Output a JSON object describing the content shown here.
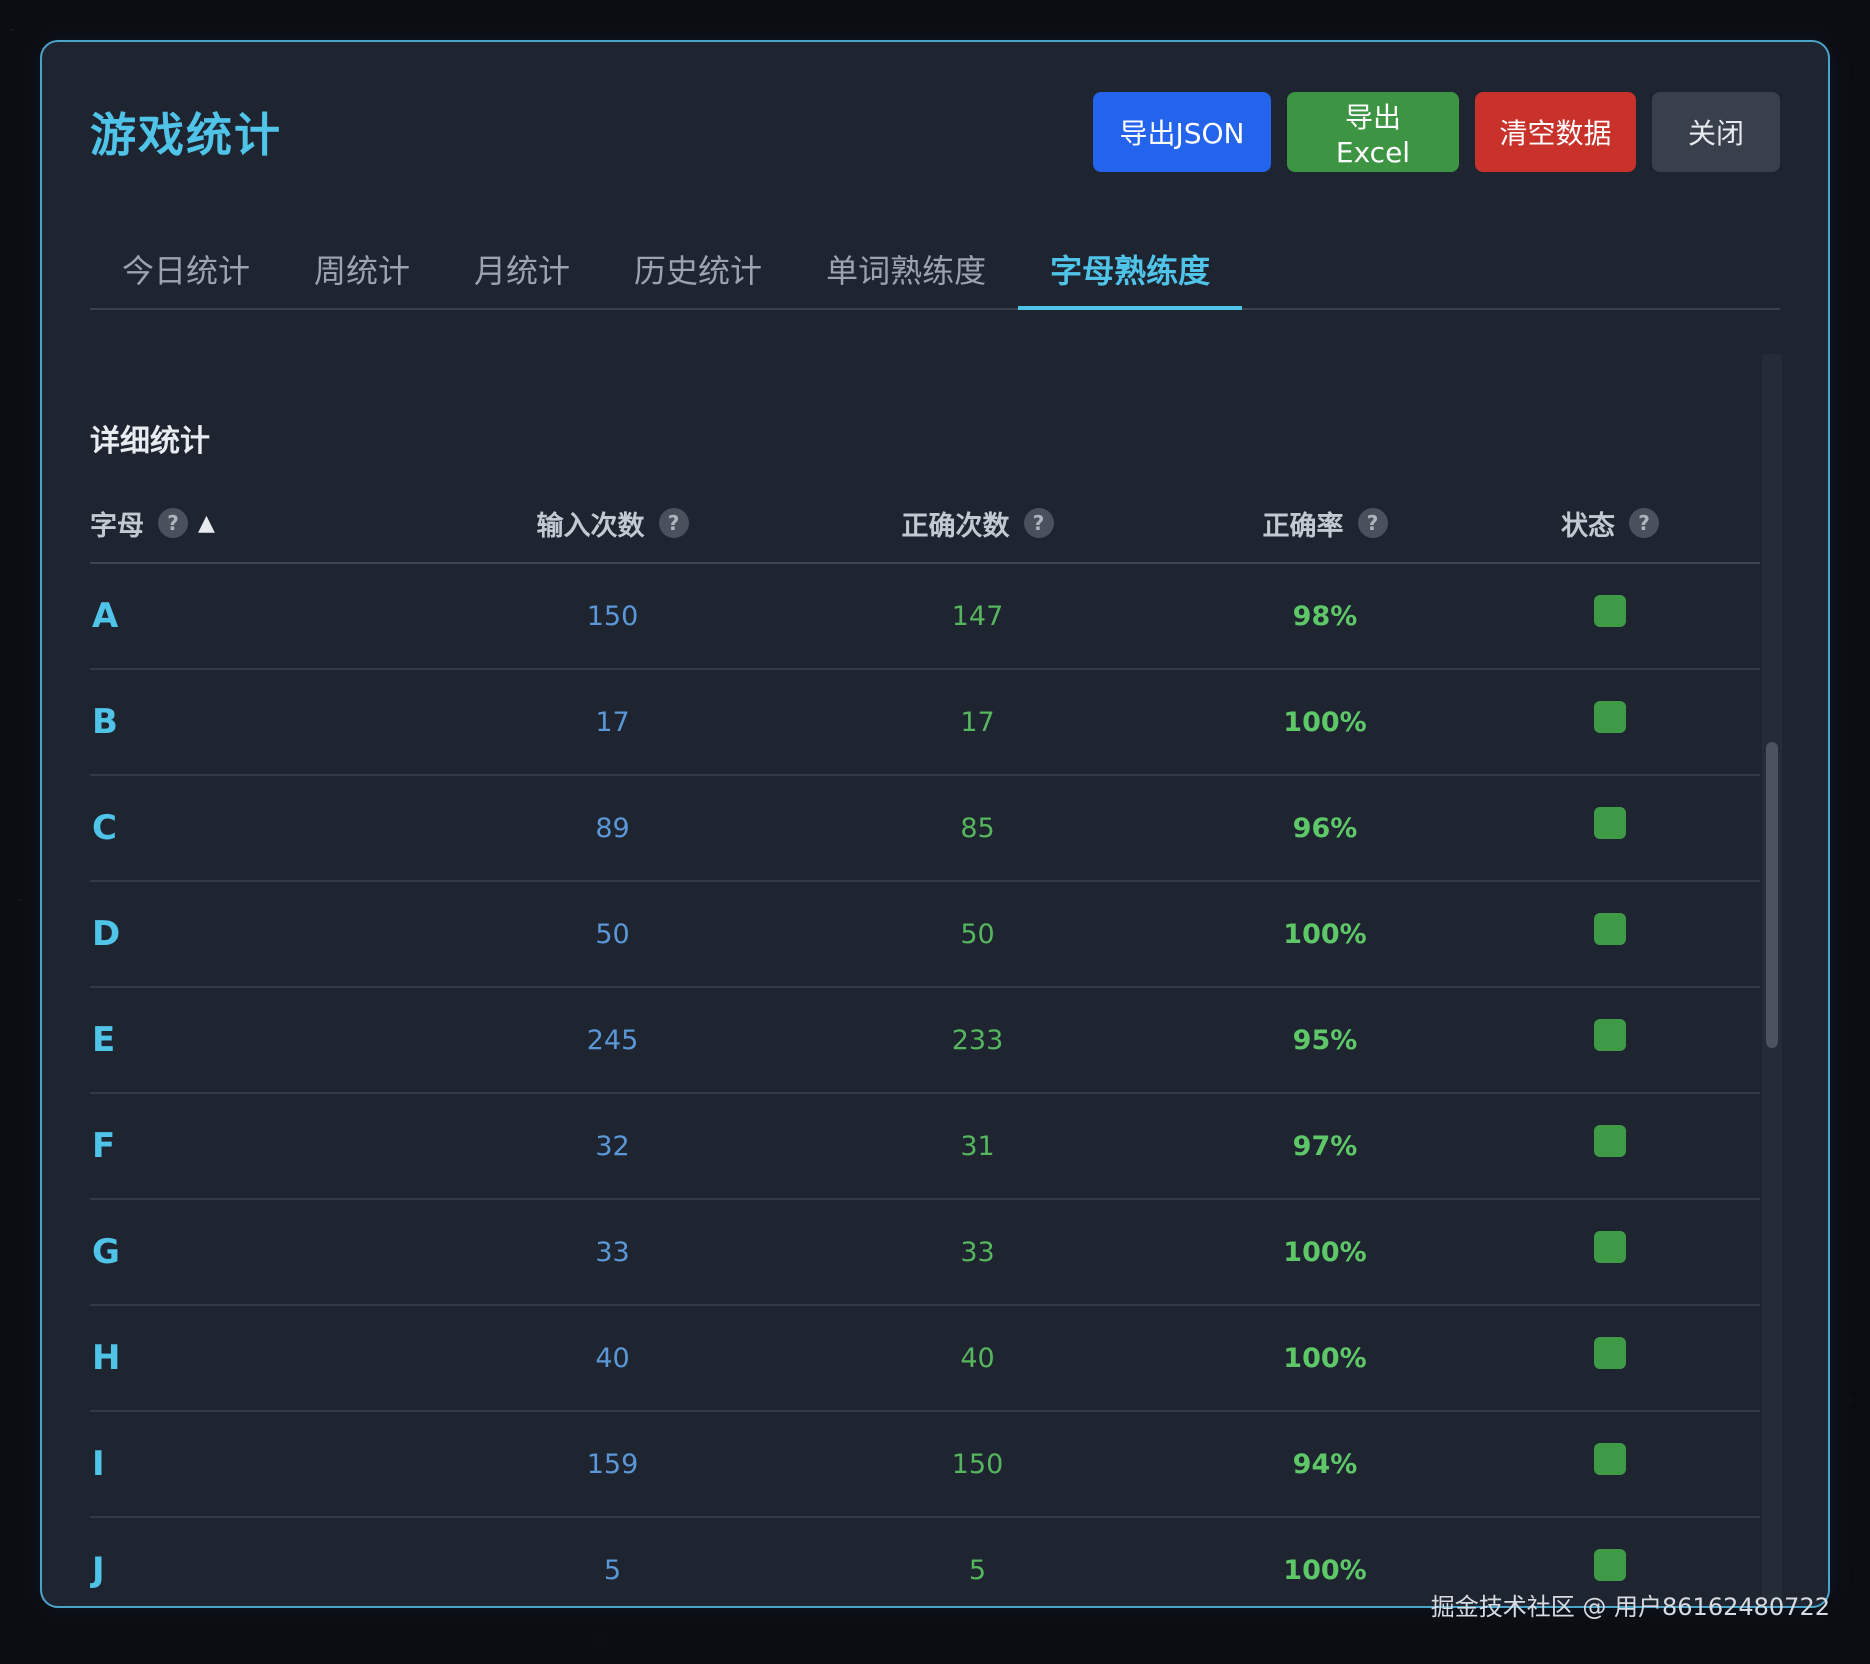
{
  "modal": {
    "title": "游戏统计",
    "buttons": {
      "export_json": "导出JSON",
      "export_excel": "导出Excel",
      "clear_data": "清空数据",
      "close": "关闭"
    }
  },
  "tabs": [
    {
      "label": "今日统计",
      "active": false
    },
    {
      "label": "周统计",
      "active": false
    },
    {
      "label": "月统计",
      "active": false
    },
    {
      "label": "历史统计",
      "active": false
    },
    {
      "label": "单词熟练度",
      "active": false
    },
    {
      "label": "字母熟练度",
      "active": true
    }
  ],
  "section": {
    "title": "详细统计"
  },
  "table": {
    "help_glyph": "?",
    "sort_glyph": "▲",
    "sort_column": "letter",
    "sort_direction": "ascending",
    "headers": {
      "letter": "字母",
      "input_count": "输入次数",
      "correct_count": "正确次数",
      "accuracy": "正确率",
      "status": "状态"
    },
    "rows": [
      {
        "letter": "A",
        "input_count": "150",
        "correct_count": "147",
        "accuracy": "98%",
        "status_color": "#3e9a47"
      },
      {
        "letter": "B",
        "input_count": "17",
        "correct_count": "17",
        "accuracy": "100%",
        "status_color": "#3e9a47"
      },
      {
        "letter": "C",
        "input_count": "89",
        "correct_count": "85",
        "accuracy": "96%",
        "status_color": "#3e9a47"
      },
      {
        "letter": "D",
        "input_count": "50",
        "correct_count": "50",
        "accuracy": "100%",
        "status_color": "#3e9a47"
      },
      {
        "letter": "E",
        "input_count": "245",
        "correct_count": "233",
        "accuracy": "95%",
        "status_color": "#3e9a47"
      },
      {
        "letter": "F",
        "input_count": "32",
        "correct_count": "31",
        "accuracy": "97%",
        "status_color": "#3e9a47"
      },
      {
        "letter": "G",
        "input_count": "33",
        "correct_count": "33",
        "accuracy": "100%",
        "status_color": "#3e9a47"
      },
      {
        "letter": "H",
        "input_count": "40",
        "correct_count": "40",
        "accuracy": "100%",
        "status_color": "#3e9a47"
      },
      {
        "letter": "I",
        "input_count": "159",
        "correct_count": "150",
        "accuracy": "94%",
        "status_color": "#3e9a47"
      },
      {
        "letter": "J",
        "input_count": "5",
        "correct_count": "5",
        "accuracy": "100%",
        "status_color": "#3e9a47"
      }
    ]
  },
  "watermark": "掘金技术社区 @ 用户86162480722",
  "colors": {
    "accent": "#4fc3e8",
    "panel_bg": "#1e2430",
    "json_button": "#2463eb",
    "excel_button": "#3d9543",
    "clear_button": "#c9312b",
    "close_button": "#3a404b",
    "input_count_text": "#5b97d6",
    "correct_count_text": "#56b65e"
  }
}
